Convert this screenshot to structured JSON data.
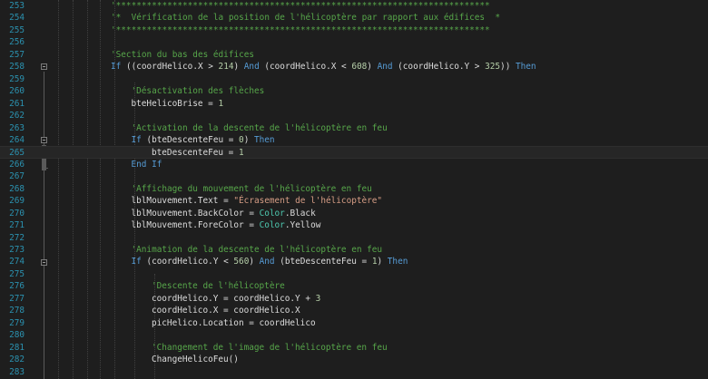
{
  "editor": {
    "lines": [
      {
        "num": "253",
        "tokens": [
          {
            "t": "'*************************************************************************",
            "c": "c"
          }
        ]
      },
      {
        "num": "254",
        "tokens": [
          {
            "t": "'*  Vérification de la position de l'hélicoptère par rapport aux édifices  *",
            "c": "c"
          }
        ]
      },
      {
        "num": "255",
        "tokens": [
          {
            "t": "'*************************************************************************",
            "c": "c"
          }
        ]
      },
      {
        "num": "256",
        "tokens": []
      },
      {
        "num": "257",
        "tokens": [
          {
            "t": "'Section du bas des édifices",
            "c": "c"
          }
        ]
      },
      {
        "num": "258",
        "tokens": [
          {
            "t": "If",
            "c": "k"
          },
          {
            "t": " ((coordHelico.X > ",
            "c": "p"
          },
          {
            "t": "214",
            "c": "n"
          },
          {
            "t": ") ",
            "c": "p"
          },
          {
            "t": "And",
            "c": "k"
          },
          {
            "t": " (coordHelico.X < ",
            "c": "p"
          },
          {
            "t": "608",
            "c": "n"
          },
          {
            "t": ") ",
            "c": "p"
          },
          {
            "t": "And",
            "c": "k"
          },
          {
            "t": " (coordHelico.Y > ",
            "c": "p"
          },
          {
            "t": "325",
            "c": "n"
          },
          {
            "t": ")) ",
            "c": "p"
          },
          {
            "t": "Then",
            "c": "k"
          }
        ]
      },
      {
        "num": "259",
        "tokens": []
      },
      {
        "num": "260",
        "indent": 1,
        "tokens": [
          {
            "t": "'Désactivation des flèches",
            "c": "c"
          }
        ]
      },
      {
        "num": "261",
        "indent": 1,
        "tokens": [
          {
            "t": "bteHelicoBrise = ",
            "c": "p"
          },
          {
            "t": "1",
            "c": "n"
          }
        ]
      },
      {
        "num": "262",
        "tokens": []
      },
      {
        "num": "263",
        "indent": 1,
        "tokens": [
          {
            "t": "'Activation de la descente de l'hélicoptère en feu",
            "c": "c"
          }
        ]
      },
      {
        "num": "264",
        "indent": 1,
        "tokens": [
          {
            "t": "If",
            "c": "k"
          },
          {
            "t": " (bteDescenteFeu = ",
            "c": "p"
          },
          {
            "t": "0",
            "c": "n"
          },
          {
            "t": ") ",
            "c": "p"
          },
          {
            "t": "Then",
            "c": "k"
          }
        ]
      },
      {
        "num": "265",
        "indent": 2,
        "current": true,
        "tokens": [
          {
            "t": "bteDescenteFeu = ",
            "c": "p"
          },
          {
            "t": "1",
            "c": "n"
          }
        ]
      },
      {
        "num": "266",
        "indent": 1,
        "tokens": [
          {
            "t": "End If",
            "c": "k"
          }
        ]
      },
      {
        "num": "267",
        "tokens": []
      },
      {
        "num": "268",
        "indent": 1,
        "tokens": [
          {
            "t": "'Affichage du mouvement de l'hélicoptère en feu",
            "c": "c"
          }
        ]
      },
      {
        "num": "269",
        "indent": 1,
        "tokens": [
          {
            "t": "lblMouvement.Text = ",
            "c": "p"
          },
          {
            "t": "\"Écrasement de l'hélicoptère\"",
            "c": "s"
          }
        ]
      },
      {
        "num": "270",
        "indent": 1,
        "tokens": [
          {
            "t": "lblMouvement.BackColor = ",
            "c": "p"
          },
          {
            "t": "Color",
            "c": "t"
          },
          {
            "t": ".Black",
            "c": "p"
          }
        ]
      },
      {
        "num": "271",
        "indent": 1,
        "tokens": [
          {
            "t": "lblMouvement.ForeColor = ",
            "c": "p"
          },
          {
            "t": "Color",
            "c": "t"
          },
          {
            "t": ".Yellow",
            "c": "p"
          }
        ]
      },
      {
        "num": "272",
        "tokens": []
      },
      {
        "num": "273",
        "indent": 1,
        "tokens": [
          {
            "t": "'Animation de la descente de l'hélicoptère en feu",
            "c": "c"
          }
        ]
      },
      {
        "num": "274",
        "indent": 1,
        "tokens": [
          {
            "t": "If",
            "c": "k"
          },
          {
            "t": " (coordHelico.Y < ",
            "c": "p"
          },
          {
            "t": "560",
            "c": "n"
          },
          {
            "t": ") ",
            "c": "p"
          },
          {
            "t": "And",
            "c": "k"
          },
          {
            "t": " (bteDescenteFeu = ",
            "c": "p"
          },
          {
            "t": "1",
            "c": "n"
          },
          {
            "t": ") ",
            "c": "p"
          },
          {
            "t": "Then",
            "c": "k"
          }
        ]
      },
      {
        "num": "275",
        "tokens": []
      },
      {
        "num": "276",
        "indent": 2,
        "tokens": [
          {
            "t": "'Descente de l'hélicoptère",
            "c": "c"
          }
        ]
      },
      {
        "num": "277",
        "indent": 2,
        "tokens": [
          {
            "t": "coordHelico.Y = coordHelico.Y + ",
            "c": "p"
          },
          {
            "t": "3",
            "c": "n"
          }
        ]
      },
      {
        "num": "278",
        "indent": 2,
        "tokens": [
          {
            "t": "coordHelico.X = coordHelico.X",
            "c": "p"
          }
        ]
      },
      {
        "num": "279",
        "indent": 2,
        "tokens": [
          {
            "t": "picHelico.Location = coordHelico",
            "c": "p"
          }
        ]
      },
      {
        "num": "280",
        "tokens": []
      },
      {
        "num": "281",
        "indent": 2,
        "tokens": [
          {
            "t": "'Changement de l'image de l'hélicoptère en feu",
            "c": "c"
          }
        ]
      },
      {
        "num": "282",
        "indent": 2,
        "tokens": [
          {
            "t": "ChangeHelicoFeu()",
            "c": "p"
          }
        ]
      },
      {
        "num": "283",
        "tokens": []
      }
    ]
  }
}
